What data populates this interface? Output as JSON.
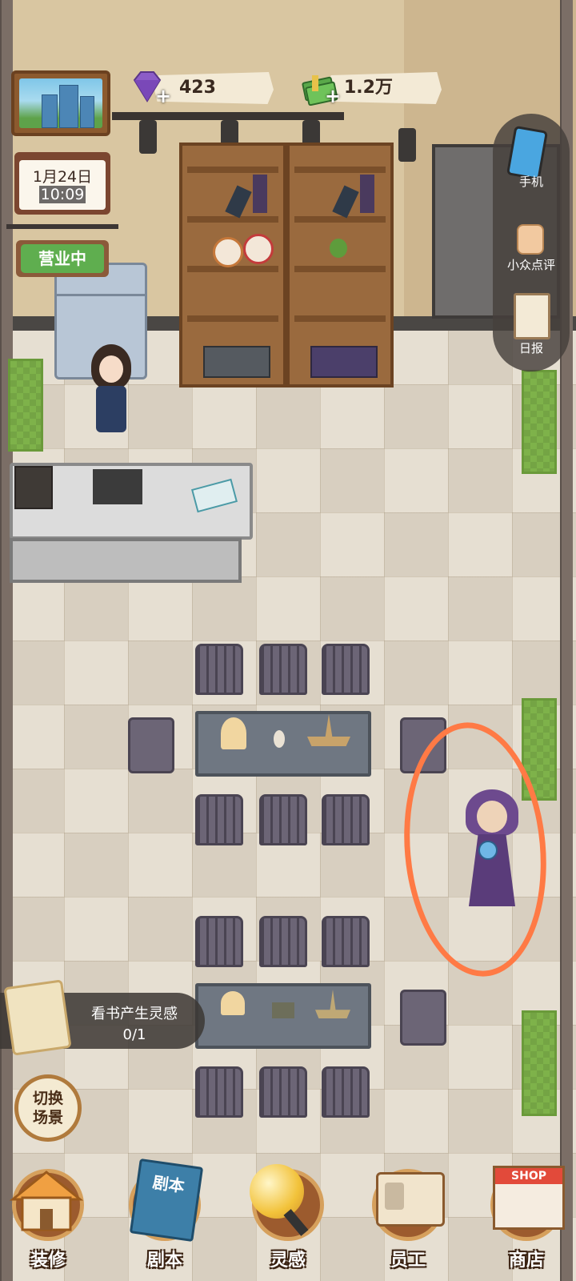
{
  "hud": {
    "calendar": {
      "date": "1月24日",
      "time": "10:09"
    },
    "open_status": "营业中",
    "gems": {
      "value": "423",
      "icon": "purple-gem-icon",
      "plus": "+"
    },
    "money": {
      "value": "1.2万",
      "icon": "cash-stack-icon",
      "plus": "+"
    }
  },
  "side_menu": [
    {
      "label": "手机",
      "icon": "phone-icon"
    },
    {
      "label": "小众点评",
      "icon": "thumbs-up-icon"
    },
    {
      "label": "日报",
      "icon": "clipboard-icon"
    }
  ],
  "quest": {
    "title": "看书产生灵感",
    "progress": "0/1",
    "icon": "scroll-icon"
  },
  "switch_scene": {
    "label": "切换场景"
  },
  "bottom_nav": [
    {
      "label": "装修",
      "icon": "house-icon"
    },
    {
      "label": "剧本",
      "icon": "script-book-icon",
      "badge": "剧本"
    },
    {
      "label": "灵感",
      "icon": "lightbulb-icon"
    },
    {
      "label": "员工",
      "icon": "id-badge-icon"
    },
    {
      "label": "商店",
      "icon": "shop-icon",
      "badge": "SHOP"
    }
  ],
  "colors": {
    "highlight": "#ff7a45",
    "open_sign": "#5fae4f"
  }
}
